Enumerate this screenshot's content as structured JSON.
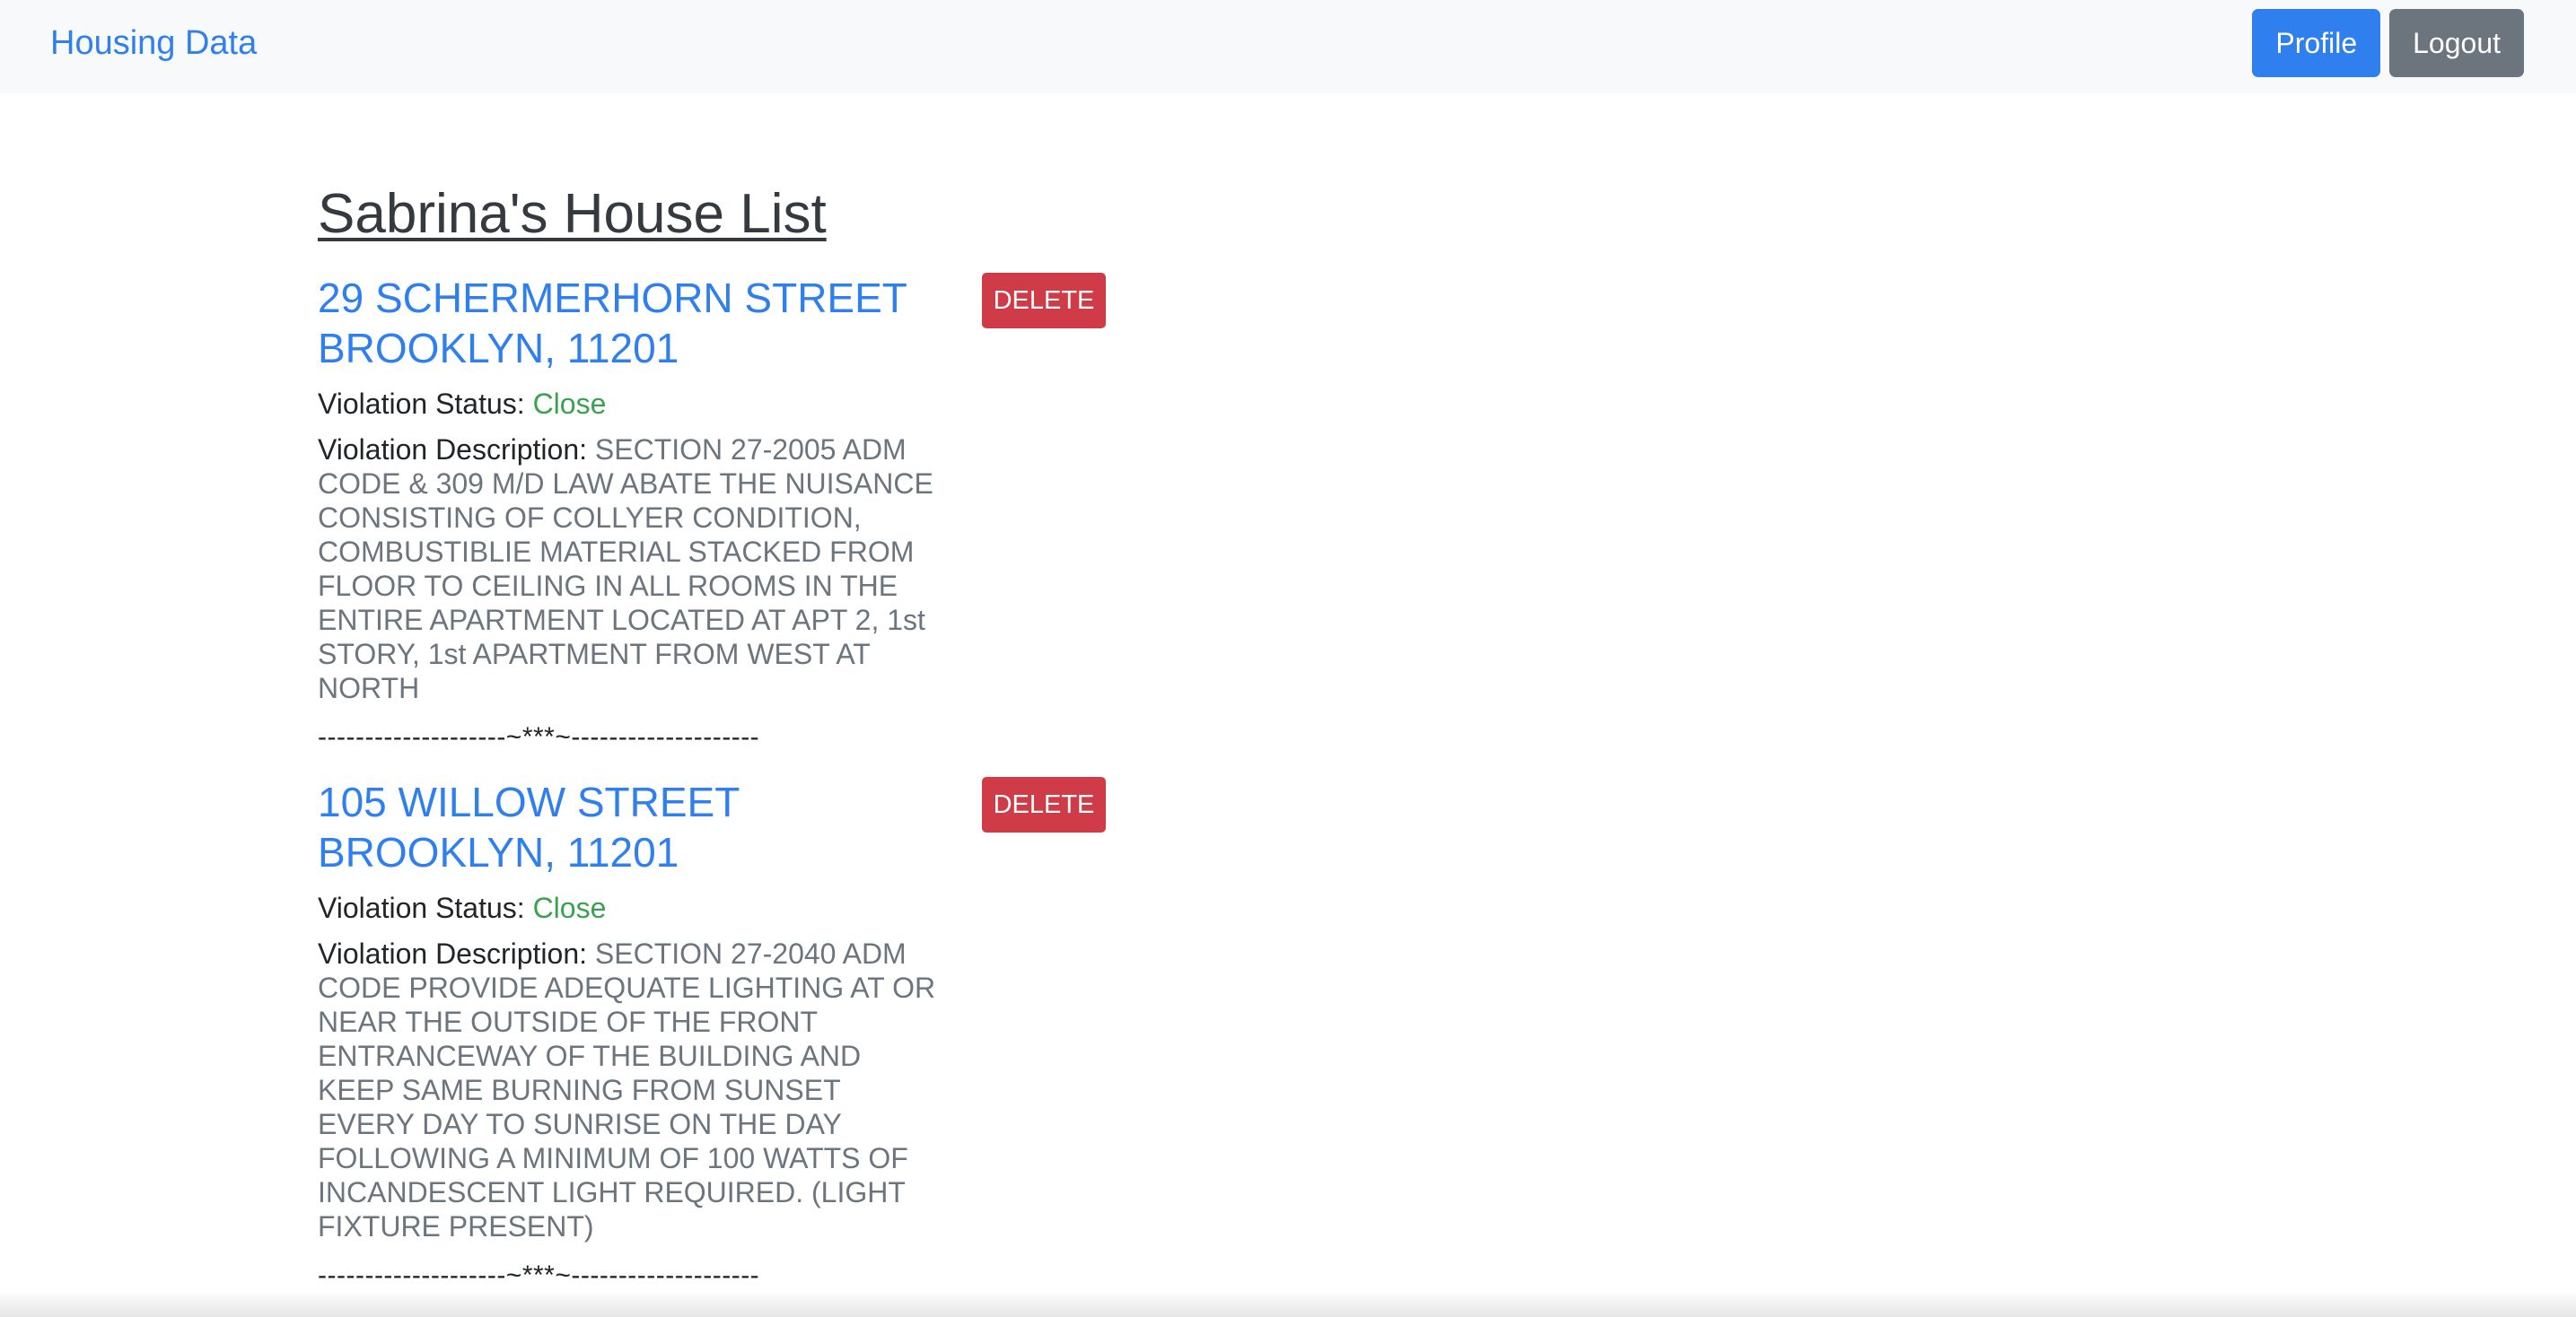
{
  "navbar": {
    "brand": "Housing Data",
    "profile_label": "Profile",
    "logout_label": "Logout"
  },
  "page": {
    "title": "Sabrina's House List"
  },
  "houses": [
    {
      "address": "29 SCHERMERHORN STREET BROOKLYN, 11201",
      "delete_label": "DELETE",
      "status_label": "Violation Status:",
      "status_value": "Close",
      "description_label": "Violation Description:",
      "description_value": "SECTION 27-2005 ADM CODE & 309 M/D LAW ABATE THE NUISANCE CONSISTING OF COLLYER CONDITION, COMBUSTIBLIE MATERIAL STACKED FROM FLOOR TO CEILING IN ALL ROOMS IN THE ENTIRE APARTMENT LOCATED AT APT 2, 1st STORY, 1st APARTMENT FROM WEST AT NORTH",
      "separator": "--------------------~***~--------------------"
    },
    {
      "address": "105 WILLOW STREET BROOKLYN, 11201",
      "delete_label": "DELETE",
      "status_label": "Violation Status:",
      "status_value": "Close",
      "description_label": "Violation Description:",
      "description_value": "SECTION 27-2040 ADM CODE PROVIDE ADEQUATE LIGHTING AT OR NEAR THE OUTSIDE OF THE FRONT ENTRANCEWAY OF THE BUILDING AND KEEP SAME BURNING FROM SUNSET EVERY DAY TO SUNRISE ON THE DAY FOLLOWING A MINIMUM OF 100 WATTS OF INCANDESCENT LIGHT REQUIRED. (LIGHT FIXTURE PRESENT)",
      "separator": "--------------------~***~--------------------"
    }
  ],
  "colors": {
    "brand_blue": "#2f7fef",
    "danger_red": "#cf3b46",
    "secondary_gray": "#6c757d",
    "status_green": "#3aa14e",
    "navbar_bg": "#f8f9fa"
  }
}
